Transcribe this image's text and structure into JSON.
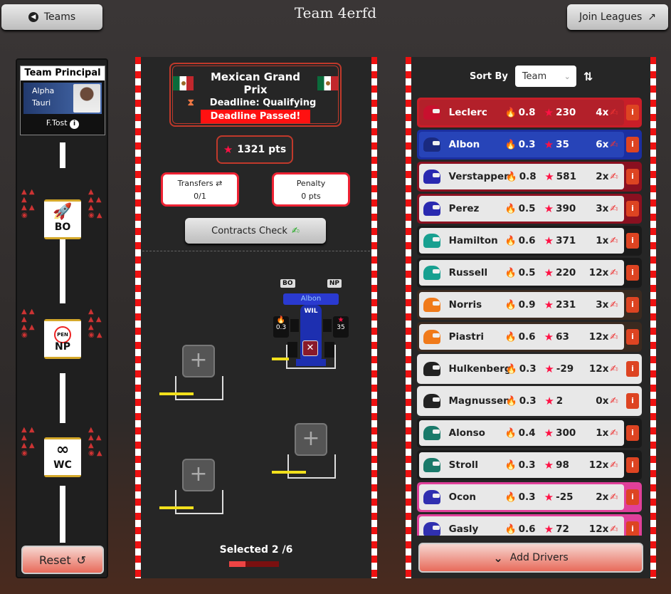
{
  "header": {
    "back_label": "Teams",
    "title": "Team 4erfd",
    "join_label": "Join Leagues"
  },
  "principal": {
    "heading": "Team Principal",
    "team_line1": "Alpha",
    "team_line2": "Tauri",
    "name": "F.Tost"
  },
  "chips": [
    {
      "label": "BO",
      "icon": "rocket-icon"
    },
    {
      "label": "NP",
      "icon": "no-penalty-icon",
      "icon_text": "PEN"
    },
    {
      "label": "WC",
      "icon": "infinity-icon"
    }
  ],
  "reset_label": "Reset",
  "race": {
    "name": "Mexican Grand Prix",
    "deadline": "Deadline: Qualifying",
    "status": "Deadline Passed!"
  },
  "points": "1321 pts",
  "transfers": {
    "label": "Transfers",
    "value": "0/1"
  },
  "penalty": {
    "label": "Penalty",
    "value": "0 pts"
  },
  "contracts_label": "Contracts Check",
  "car": {
    "driver": "Albon",
    "team": "WIL",
    "cost": "0.3",
    "points": "35",
    "chip1": "BO",
    "chip2": "NP"
  },
  "slot_plus": "+",
  "selected": "Selected 2 /6",
  "selected_progress": 0.333,
  "sort": {
    "label": "Sort By",
    "value": "Team"
  },
  "drivers": [
    {
      "name": "Leclerc",
      "cost": "0.8",
      "points": "230",
      "mult": "4x",
      "bg": "#b3202a",
      "border": "#c81e28",
      "text": "#fff",
      "helmet": "#c8102e"
    },
    {
      "name": "Albon",
      "cost": "0.3",
      "points": "35",
      "mult": "6x",
      "bg": "#2744b8",
      "border": "#1b2fa0",
      "text": "#fff",
      "helmet": "#1a2a80"
    },
    {
      "name": "Verstappen",
      "cost": "0.8",
      "points": "581",
      "mult": "2x",
      "bg": "#e8e8e8",
      "border": "#8a1020",
      "text": "#222",
      "helmet": "#2a2ab0"
    },
    {
      "name": "Perez",
      "cost": "0.5",
      "points": "390",
      "mult": "3x",
      "bg": "#e8e8e8",
      "border": "#8a1020",
      "text": "#222",
      "helmet": "#2a2ab0"
    },
    {
      "name": "Hamilton",
      "cost": "0.6",
      "points": "371",
      "mult": "1x",
      "bg": "#e8e8e8",
      "border": "#1a1a1a",
      "text": "#222",
      "helmet": "#18a090"
    },
    {
      "name": "Russell",
      "cost": "0.5",
      "points": "220",
      "mult": "12x",
      "bg": "#e8e8e8",
      "border": "#1a1a1a",
      "text": "#222",
      "helmet": "#18a090"
    },
    {
      "name": "Norris",
      "cost": "0.9",
      "points": "231",
      "mult": "3x",
      "bg": "#e8e8e8",
      "border": "#3a2a20",
      "text": "#222",
      "helmet": "#f07a1a"
    },
    {
      "name": "Piastri",
      "cost": "0.6",
      "points": "63",
      "mult": "12x",
      "bg": "#e8e8e8",
      "border": "#3a2a20",
      "text": "#222",
      "helmet": "#f07a1a"
    },
    {
      "name": "Hulkenberg",
      "cost": "0.3",
      "points": "-29",
      "mult": "12x",
      "bg": "#e8e8e8",
      "border": "#e8e8e8",
      "text": "#222",
      "helmet": "#222"
    },
    {
      "name": "Magnussen",
      "cost": "0.3",
      "points": "2",
      "mult": "0x",
      "bg": "#e8e8e8",
      "border": "#e8e8e8",
      "text": "#222",
      "helmet": "#222"
    },
    {
      "name": "Alonso",
      "cost": "0.4",
      "points": "300",
      "mult": "1x",
      "bg": "#e8e8e8",
      "border": "#1a1a1a",
      "text": "#222",
      "helmet": "#1a7a6a"
    },
    {
      "name": "Stroll",
      "cost": "0.3",
      "points": "98",
      "mult": "12x",
      "bg": "#e8e8e8",
      "border": "#1a1a1a",
      "text": "#222",
      "helmet": "#1a7a6a"
    },
    {
      "name": "Ocon",
      "cost": "0.3",
      "points": "-25",
      "mult": "2x",
      "bg": "#e8e8e8",
      "border": "#e0409a",
      "text": "#222",
      "helmet": "#3030b0"
    },
    {
      "name": "Gasly",
      "cost": "0.6",
      "points": "72",
      "mult": "12x",
      "bg": "#e8e8e8",
      "border": "#e0409a",
      "text": "#222",
      "helmet": "#3030b0"
    }
  ],
  "add_label": "Add Drivers",
  "colors": {
    "accent": "#e23",
    "yellow": "#f2e01c"
  }
}
